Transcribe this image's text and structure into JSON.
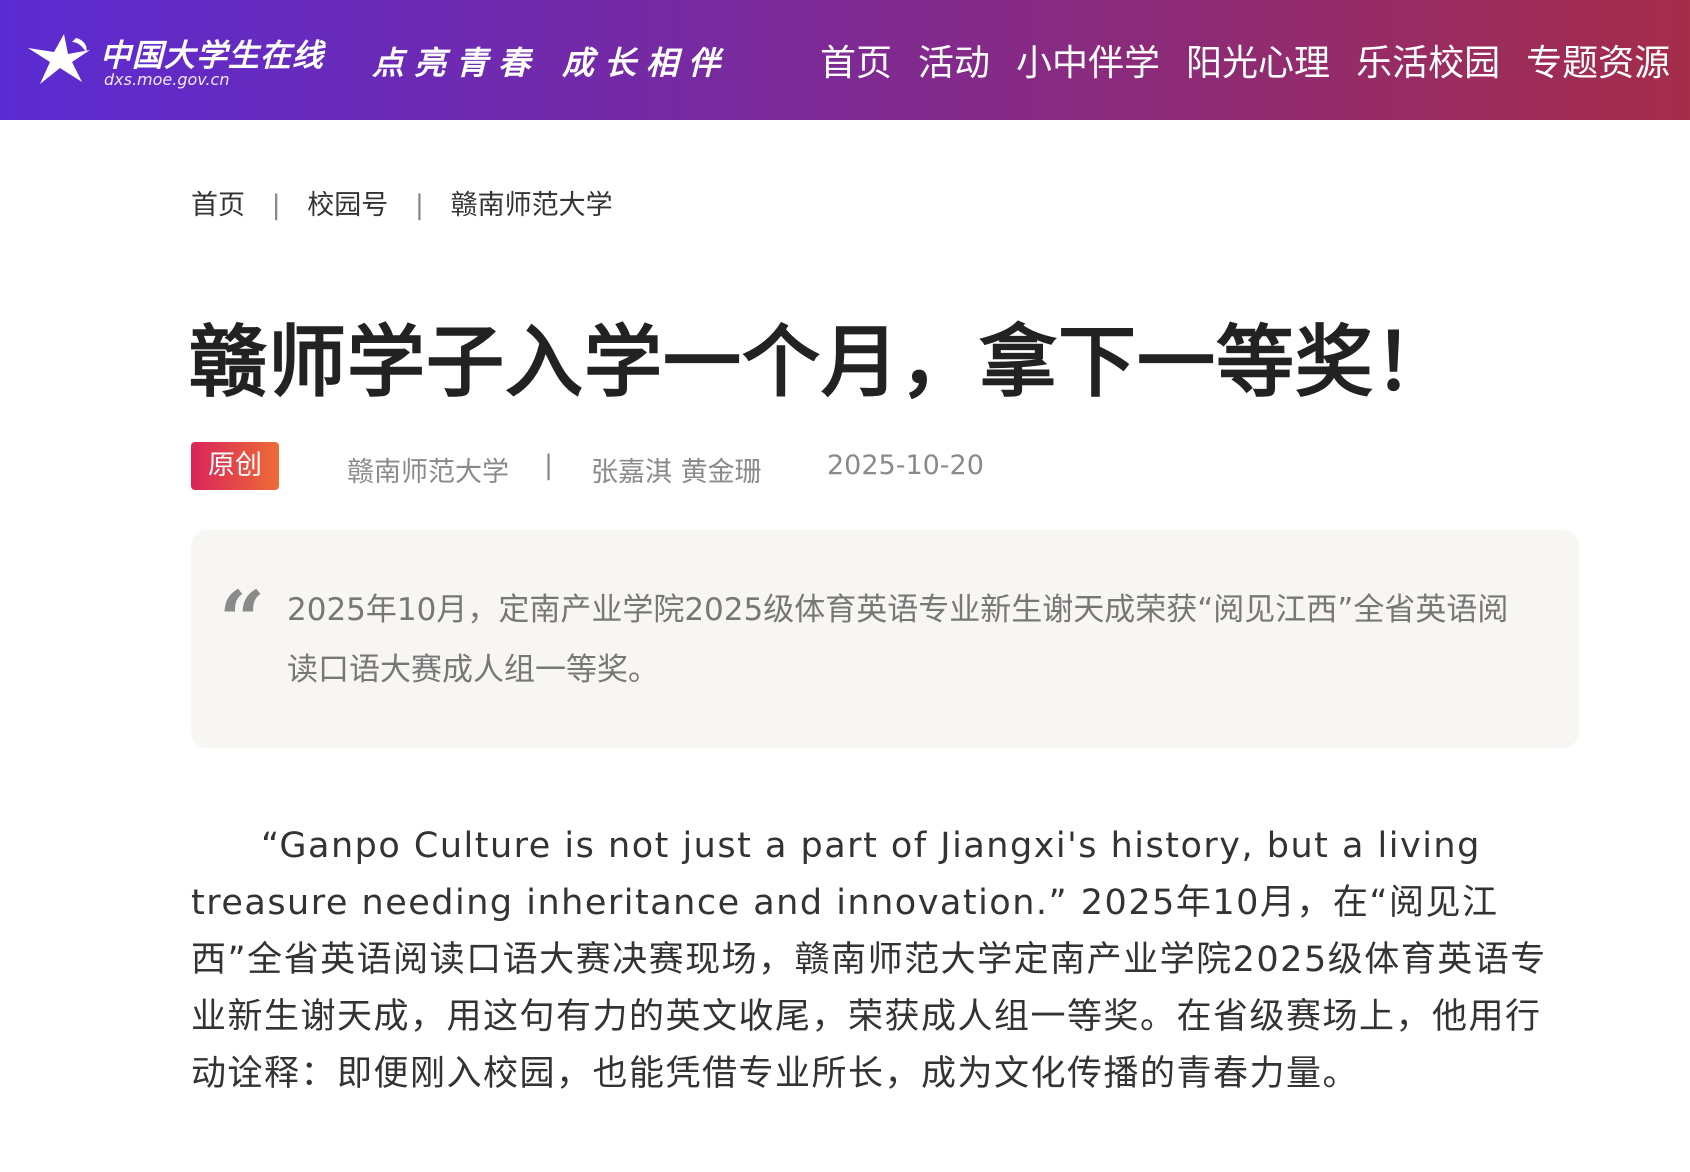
{
  "header": {
    "logo_cn": "中国大学生在线",
    "logo_en": "dxs.moe.gov.cn",
    "slogan_1": "点亮青春",
    "slogan_2": "成长相伴",
    "nav": [
      {
        "label": "首页"
      },
      {
        "label": "活动"
      },
      {
        "label": "小中伴学"
      },
      {
        "label": "阳光心理"
      },
      {
        "label": "乐活校园"
      },
      {
        "label": "专题资源"
      }
    ]
  },
  "breadcrumb": {
    "separator": "|",
    "items": [
      {
        "label": "首页"
      },
      {
        "label": "校园号"
      },
      {
        "label": "赣南师范大学"
      }
    ]
  },
  "article": {
    "title": "赣师学子入学一个月，拿下一等奖！",
    "badge": "原创",
    "school": "赣南师范大学",
    "meta_separator": "|",
    "authors": "张嘉淇 黄金珊",
    "date": "2025-10-20",
    "summary_mark": "“",
    "summary": "2025年10月，定南产业学院2025级体育英语专业新生谢天成荣获“阅见江西”全省英语阅读口语大赛成人组一等奖。",
    "body": "“Ganpo Culture is not just a part of Jiangxi's history, but a living treasure needing inheritance and innovation.” 2025年10月，在“阅见江西”全省英语阅读口语大赛决赛现场，赣南师范大学定南产业学院2025级体育英语专业新生谢天成，用这句有力的英文收尾，荣获成人组一等奖。在省级赛场上，他用行动诠释：即便刚入校园，也能凭借专业所长，成为文化传播的青春力量。"
  },
  "colors": {
    "header_gradient_start": "#5b2bd2",
    "header_gradient_end": "#a52c4a",
    "badge_gradient_start": "#d8245a",
    "badge_gradient_end": "#ee6c36",
    "quote_background": "#f8f6f2"
  }
}
